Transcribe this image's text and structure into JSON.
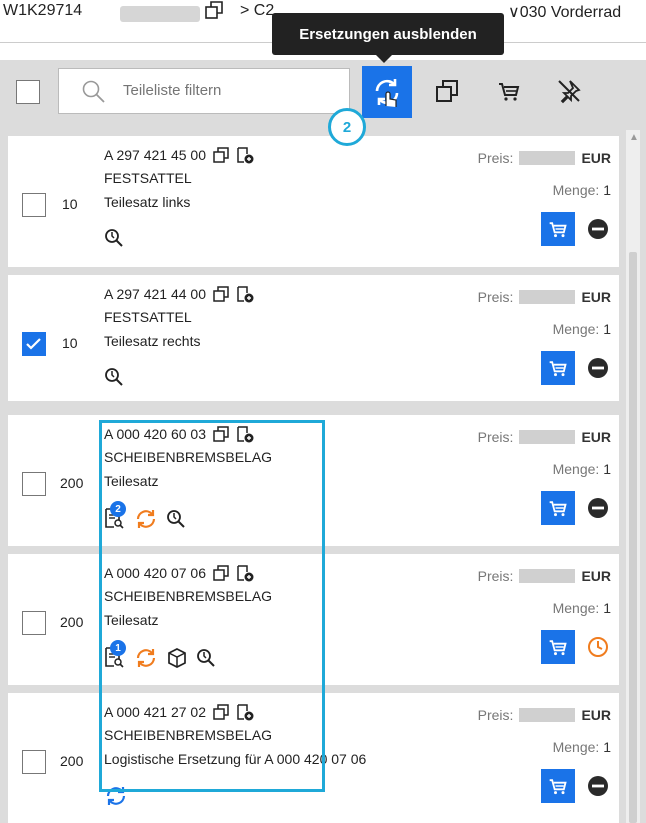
{
  "breadcrumb": {
    "vin": "W1K29714",
    "crumb2": "> C2",
    "crumb3": "∨030 Vorderrad"
  },
  "tooltip": "Ersetzungen ausblenden",
  "step_badge": "2",
  "toolbar": {
    "filter_placeholder": "Teileliste filtern",
    "icons": [
      "replacements-toggle-icon",
      "copy-icon",
      "cart-icon",
      "unpin-icon"
    ]
  },
  "labels": {
    "price": "Preis:",
    "currency": "EUR",
    "quantity": "Menge:"
  },
  "parts": [
    {
      "qty": "10",
      "part_no": "A 297 421 45 00",
      "name": "FESTSATTEL",
      "desc": "Teilesatz links",
      "menge": "1",
      "checked": false,
      "action": "remove"
    },
    {
      "qty": "10",
      "part_no": "A 297 421 44 00",
      "name": "FESTSATTEL",
      "desc": "Teilesatz rechts",
      "menge": "1",
      "checked": true,
      "action": "remove"
    },
    {
      "qty": "200",
      "part_no": "A 000 420 60 03",
      "name": "SCHEIBENBREMSBELAG",
      "desc": "Teilesatz",
      "menge": "1",
      "checked": false,
      "action": "remove",
      "doc_badge": "2"
    },
    {
      "qty": "200",
      "part_no": "A 000 420 07 06",
      "name": "SCHEIBENBREMSBELAG",
      "desc": "Teilesatz",
      "menge": "1",
      "checked": false,
      "action": "clock",
      "doc_badge": "1"
    },
    {
      "qty": "200",
      "part_no": "A 000 421 27 02",
      "name": "SCHEIBENBREMSBELAG",
      "desc": "Logistische Ersetzung für A 000 420 07 06",
      "menge": "1",
      "checked": false,
      "action": "remove"
    }
  ],
  "colors": {
    "accent": "#1a73e8",
    "highlight": "#1fa9d8",
    "replacement": "#f07c1e",
    "toolbar_bg": "#dcdcdc"
  }
}
